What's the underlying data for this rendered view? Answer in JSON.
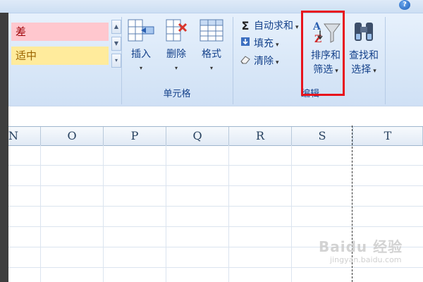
{
  "ribbon": {
    "help_icon": "?",
    "styles": {
      "bad_label": "差",
      "neutral_label": "适中",
      "scroll_up": "▲",
      "scroll_down": "▼",
      "more": "▾"
    },
    "cells_group": {
      "label": "单元格",
      "insert_label": "插入",
      "delete_label": "删除",
      "format_label": "格式",
      "dropdown": "▾"
    },
    "editing_group": {
      "label": "编辑",
      "autosum_label": "自动求和",
      "fill_label": "填充",
      "clear_label": "清除",
      "sort_filter_label_1": "排序和",
      "sort_filter_label_2": "筛选",
      "find_select_label_1": "查找和",
      "find_select_label_2": "选择",
      "dropdown": "▾"
    }
  },
  "sheet": {
    "columns": [
      "N",
      "O",
      "P",
      "Q",
      "R",
      "S",
      "T"
    ]
  },
  "watermark": {
    "text": "Baidu 经验",
    "sub": "jingyan.baidu.com"
  },
  "colors": {
    "highlight": "#e8141c",
    "bad_fill": "#ffc7ce",
    "neutral_fill": "#ffeb9c"
  }
}
